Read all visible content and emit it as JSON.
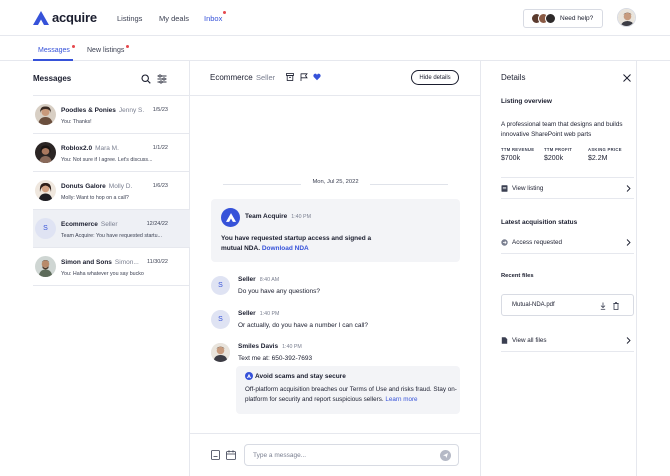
{
  "brand": {
    "name": "acquire",
    "color": "#3652d9"
  },
  "nav": {
    "items": [
      "Listings",
      "My deals",
      "Inbox"
    ],
    "active": "Inbox"
  },
  "help": {
    "label": "Need help?"
  },
  "subtabs": {
    "messages": "Messages",
    "new_listings": "New listings"
  },
  "left": {
    "title": "Messages",
    "conversations": [
      {
        "name": "Poodles & Ponies",
        "person": "Jenny S.",
        "date": "1/5/23",
        "preview": "You: Thanks!",
        "avatar": "photo"
      },
      {
        "name": "Roblox2.0",
        "person": "Mara M.",
        "date": "1/1/22",
        "preview": "You: Not sure if I agree. Let's discuss...",
        "avatar": "photo"
      },
      {
        "name": "Donuts Galore",
        "person": "Molly D.",
        "date": "1/6/23",
        "preview": "Molly: Want to hop on a call?",
        "avatar": "photo"
      },
      {
        "name": "Ecommerce",
        "person": "Seller",
        "date": "12/24/22",
        "preview": "Team Acquire: You have requested startu...",
        "avatar": "S"
      },
      {
        "name": "Simon and Sons",
        "person": "Simon...",
        "date": "11/30/22",
        "preview": "You: Haha whatever you say bucko",
        "avatar": "photo"
      }
    ]
  },
  "chat": {
    "title": "Ecommerce",
    "subtitle": "Seller",
    "hide_details": "Hide details",
    "date": "Mon, Jul 25, 2022",
    "system": {
      "name": "Team Acquire",
      "time": "1:40 PM",
      "text": "You have requested startup access and signed a mutual NDA.",
      "link": "Download NDA"
    },
    "messages": [
      {
        "name": "Seller",
        "time": "8:40 AM",
        "text": "Do you have any questions?",
        "avatar": "S"
      },
      {
        "name": "Seller",
        "time": "1:40 PM",
        "text": "Or actually, do you have a number I can call?",
        "avatar": "S"
      },
      {
        "name": "Smiles Davis",
        "time": "1:40 PM",
        "text": "Text me at: 650-392-7693",
        "avatar": "photo"
      }
    ],
    "warning": {
      "title": "Avoid scams and stay secure",
      "text": "Off-platform acquisition breaches our Terms of Use and risks fraud. Stay on-platform for security and report suspicious sellers.",
      "link": "Learn more"
    },
    "composer_placeholder": "Type a message..."
  },
  "details": {
    "title": "Details",
    "overview_title": "Listing overview",
    "overview_text": "A professional team that designs and builds innovative SharePoint web parts",
    "stats": [
      {
        "label": "TTM REVENUE",
        "value": "$700k"
      },
      {
        "label": "TTM PROFIT",
        "value": "$200k"
      },
      {
        "label": "ASKING PRICE",
        "value": "$2.2M"
      }
    ],
    "view_listing": "View listing",
    "status_title": "Latest acquisition status",
    "status_value": "Access requested",
    "files_title": "Recent files",
    "file_name": "Mutual-NDA.pdf",
    "view_all_files": "View all files"
  }
}
